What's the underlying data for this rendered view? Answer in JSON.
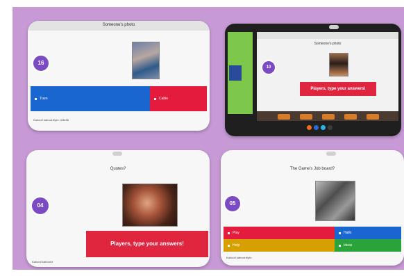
{
  "cards": [
    {
      "number": "16",
      "title": "Someone’s photo",
      "answers": [
        {
          "label": "Tram",
          "color": "#1a66d1"
        },
        {
          "label": "Cable",
          "color": "#e41b3c"
        }
      ],
      "footer": "Kahoot! kahoot.it/pin 123456"
    },
    {
      "number": "10",
      "title": "Someone’s photo",
      "button": "Players, type your answers!",
      "side_color": "#7dc84a",
      "tray_colors": [
        "#d87b2a",
        "#d87b2a",
        "#d87b2a",
        "#d87b2a",
        "#d87b2a"
      ],
      "dock_colors": [
        "#f26b1d",
        "#2e6cd4",
        "#2bb5e5",
        "#3b3b3b"
      ]
    },
    {
      "number": "04",
      "title": "Quotes?",
      "button": "Players, type your answers!",
      "footer": "Kahoot! kahoot.it"
    },
    {
      "number": "05",
      "title": "The Game’s Job board?",
      "answers": [
        {
          "label": "Play",
          "color": "#e41b3c"
        },
        {
          "label": "Hallo",
          "color": "#1a66d1"
        },
        {
          "label": "Help",
          "color": "#d6a000"
        },
        {
          "label": "Ideas",
          "color": "#2aa33a"
        }
      ],
      "footer": "Kahoot! kahoot.it/pin"
    }
  ]
}
